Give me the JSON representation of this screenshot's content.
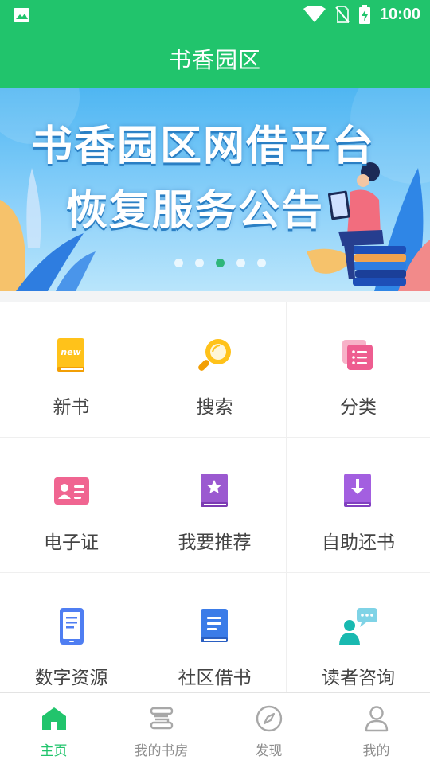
{
  "status_bar": {
    "time": "10:00",
    "icons": [
      "image-icon",
      "wifi-icon",
      "no-sim-icon",
      "battery-charging-icon"
    ]
  },
  "app_bar": {
    "title": "书香园区"
  },
  "banner": {
    "headline_line1": "书香园区网借平台",
    "headline_line2": "恢复服务公告",
    "slides_count": 5,
    "active_slide": 3
  },
  "menu": {
    "items": [
      {
        "label": "新书",
        "icon": "new-book-icon"
      },
      {
        "label": "搜索",
        "icon": "magnifier-icon"
      },
      {
        "label": "分类",
        "icon": "category-list-icon"
      },
      {
        "label": "电子证",
        "icon": "id-card-icon"
      },
      {
        "label": "我要推荐",
        "icon": "star-book-icon"
      },
      {
        "label": "自助还书",
        "icon": "return-book-icon"
      },
      {
        "label": "数字资源",
        "icon": "phone-document-icon"
      },
      {
        "label": "社区借书",
        "icon": "blue-book-icon"
      },
      {
        "label": "读者咨询",
        "icon": "chat-user-icon"
      }
    ]
  },
  "tab_bar": {
    "tabs": [
      {
        "label": "主页",
        "icon": "home-icon",
        "active": true
      },
      {
        "label": "我的书房",
        "icon": "bookshelf-icon",
        "active": false
      },
      {
        "label": "发现",
        "icon": "compass-icon",
        "active": false
      },
      {
        "label": "我的",
        "icon": "profile-icon",
        "active": false
      }
    ]
  },
  "colors": {
    "brand_green": "#21c46c",
    "inactive_gray": "#8e8e8e"
  }
}
